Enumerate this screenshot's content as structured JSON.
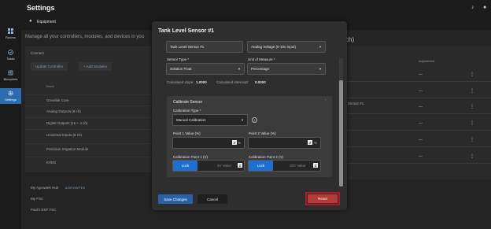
{
  "app": {
    "title": "Settings",
    "breadcrumb": "Equipment"
  },
  "sidebar": {
    "items": [
      {
        "label": "Rooms",
        "icon": "grid-icon"
      },
      {
        "label": "Tasks",
        "icon": "check-circle-icon"
      },
      {
        "label": "Blueprints",
        "icon": "blueprint-icon"
      },
      {
        "label": "Settings",
        "icon": "gear-icon",
        "active": true
      }
    ]
  },
  "background": {
    "description": "Manage all your controllers, modules, and devices in you",
    "connect_label": "Connect",
    "update_controller": "Update Controller",
    "add_modules": "+ Add Modules",
    "name_header": "Name",
    "rows": [
      "Growlink Core",
      "Analog Outputs (8 ch)",
      "Digital Outputs (16 + 4 ch)",
      "Universal Inputs (8 ch)",
      "Precision Irrigation Module",
      "EXM1"
    ],
    "list": [
      "My Agrowtek Hub",
      "My FSC",
      "Paul's ESP FSC"
    ],
    "logo_text": "AGROWTEK",
    "right_title_suffix": "ch)",
    "adjustment_header": "Adjustment",
    "right_row_text": "el Sensor #1",
    "dash": "—"
  },
  "modal": {
    "title": "Tank Level Sensor #1",
    "name_value": "Tank Level Sensor #1",
    "input_type": "Analog Voltage (0-10v Input)",
    "sensor_type_label": "Sensor Type *",
    "sensor_type_value": "Solution Float",
    "unit_label": "Unit of Measure *",
    "unit_value": "Percentage",
    "slope_label": "Calculated slope:",
    "slope_value": "1.0000",
    "intercept_label": "Calculated intercept:",
    "intercept_value": "0.0000",
    "calibrate": {
      "title": "Calibrate Sensor",
      "type_label": "Calibration Type *",
      "type_value": "Manual Calibration",
      "p1_label": "Point 1 Value (%)",
      "p2_label": "Point 2 Value (%)",
      "percent_unit": "%",
      "cp1_label": "Calibration Point 1 (V)",
      "cp2_label": "Calibration Point 2 (V)",
      "lock_label": "Lock",
      "cp1_volt": "4V Value",
      "cp2_volt": "30V Value"
    },
    "save_label": "Save Changes",
    "cancel_label": "Cancel",
    "reset_label": "Reset"
  },
  "colors": {
    "accent": "#1f6fd1",
    "reset": "#b43a3a",
    "reset_outline": "#b0192c"
  }
}
